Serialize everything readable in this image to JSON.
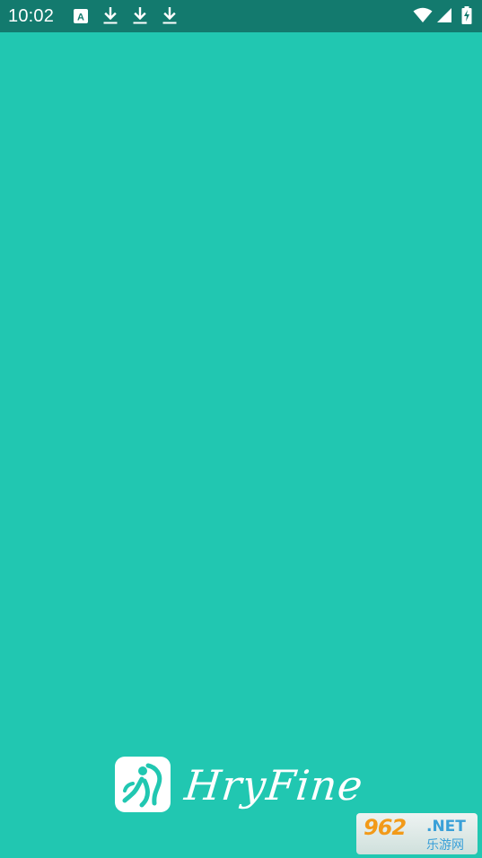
{
  "status_bar": {
    "time": "10:02",
    "notification_icons": [
      "app-notification-icon",
      "download-icon",
      "download-icon",
      "download-icon"
    ],
    "system_icons": [
      "wifi-icon",
      "cellular-signal-icon",
      "battery-charging-icon"
    ],
    "color": "#137a6e"
  },
  "splash": {
    "background_color": "#21c7b1",
    "brand_name": "HryFine",
    "logo_icon": "running-figure-icon"
  },
  "watermark": {
    "number": "962",
    "suffix": ".NET",
    "site_name": "乐游网"
  }
}
